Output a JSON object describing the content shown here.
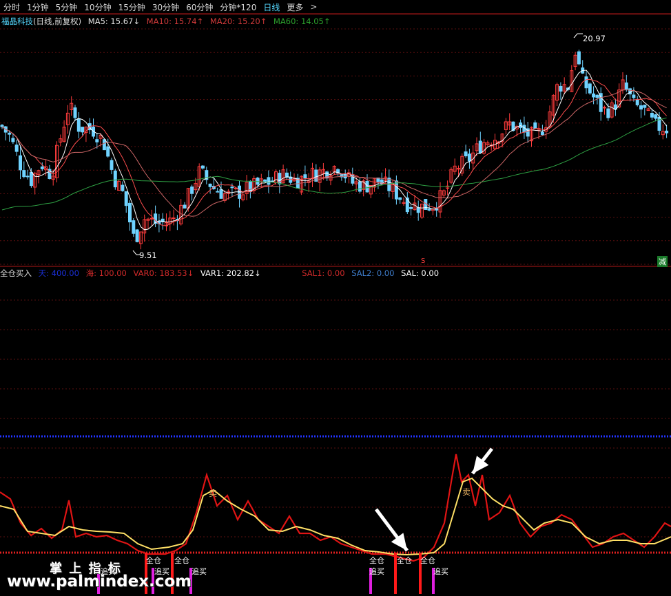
{
  "toolbar": {
    "tabs": [
      "分时",
      "1分钟",
      "5分钟",
      "10分钟",
      "15分钟",
      "30分钟",
      "60分钟",
      "分钟*120",
      "日线",
      "更多"
    ],
    "active_tab": "日线",
    "next_glyph": ">"
  },
  "main_panel": {
    "stock_label": "福晶科技",
    "mode_label": "(日线,前复权)",
    "ma_labels": [
      {
        "text": "MA5: 15.67↓",
        "color": "#e0e0e0"
      },
      {
        "text": "MA10: 15.74↑",
        "color": "#d23a3a"
      },
      {
        "text": "MA20: 15.20↑",
        "color": "#d23a3a"
      },
      {
        "text": "MA60: 14.05↑",
        "color": "#2ca02c"
      }
    ],
    "high_label": "20.97",
    "low_label": "9.51",
    "s_marker": "S",
    "reduce_badge": "减"
  },
  "indicator_panel": {
    "title": "全仓买入",
    "values": [
      {
        "text": "天: 400.00",
        "color": "#1a2fd9"
      },
      {
        "text": "海: 100.00",
        "color": "#d22a2a"
      },
      {
        "text": "VAR0: 183.53↓",
        "color": "#d22a2a"
      },
      {
        "text": "VAR1: 202.82↓",
        "color": "#ffffff"
      },
      {
        "text": "SAL1: 0.00",
        "color": "#d22a2a"
      },
      {
        "text": "SAL2: 0.00",
        "color": "#3f7fcf"
      },
      {
        "text": "SAL: 0.00",
        "color": "#ffffff"
      }
    ],
    "signal_full": "全仓",
    "signal_chase": "追买",
    "signal_sell": "卖"
  },
  "watermark": {
    "line1": "掌 上 指 标",
    "line2": "www.palmindex.com"
  },
  "colors": {
    "bull": "#ff3c3c",
    "bear": "#6fd3ff",
    "ma5": "#ffffff",
    "ma10": "#ff4d4d",
    "ma20": "#cc6666",
    "ma60": "#2ea043",
    "var0": "#e01414",
    "var1": "#ffe066",
    "blue_level": "#2233ff",
    "red_level": "#e02020"
  },
  "chart_data": {
    "type": "candlestick",
    "price_high": 20.97,
    "price_low": 9.51
  }
}
